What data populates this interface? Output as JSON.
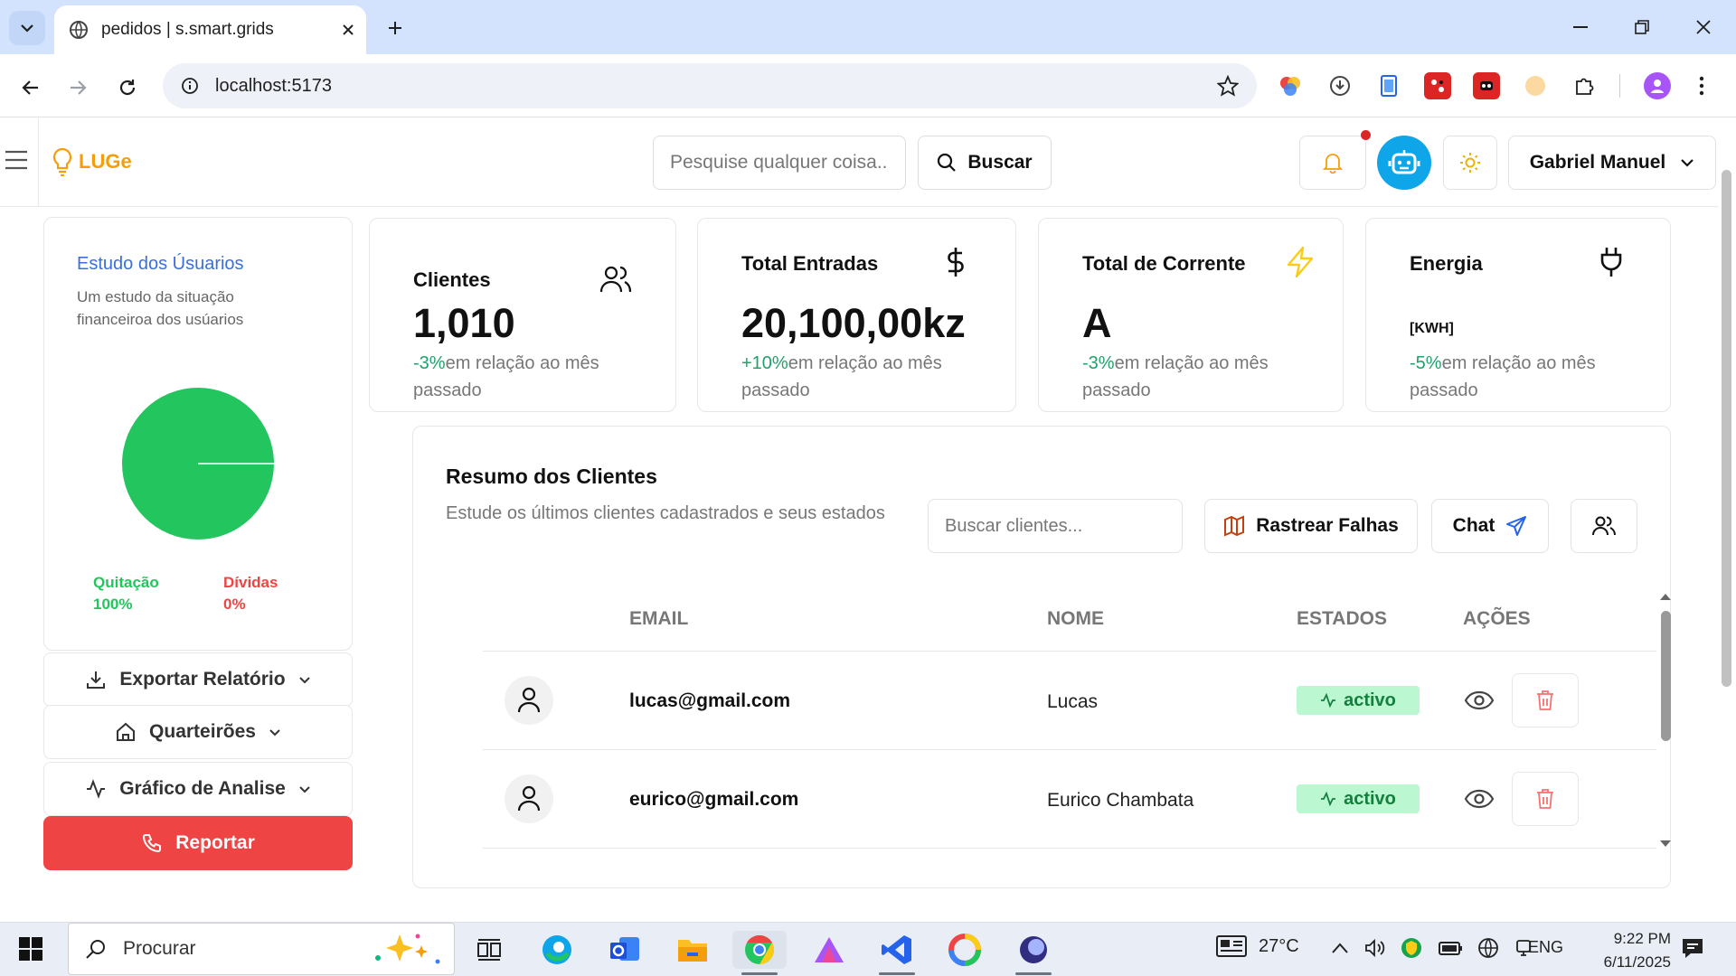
{
  "browser": {
    "tab_title": "pedidos | s.smart.grids",
    "url": "localhost:5173"
  },
  "header": {
    "brand": "LUGe",
    "search_placeholder": "Pesquise qualquer coisa..",
    "search_button": "Buscar",
    "user_name": "Gabriel Manuel",
    "notification_color": "#dc2626",
    "bot_color": "#0ea5e9"
  },
  "sidebar": {
    "study_title": "Estudo dos Úsuarios",
    "study_description": "Um estudo da situação financeiroa dos usúarios",
    "chart_data": {
      "type": "pie",
      "series": [
        {
          "name": "Quitação",
          "value": 100,
          "color": "#22c55e"
        },
        {
          "name": "Dívidas",
          "value": 0,
          "color": "#ef4444"
        }
      ]
    },
    "legend_paid_label": "Quitação",
    "legend_paid_value": "100%",
    "legend_debt_label": "Dívidas",
    "legend_debt_value": "0%",
    "export_button": "Exportar Relatório",
    "blocks_button": "Quarteirões",
    "analysis_button": "Gráfico de Analise",
    "report_button": "Reportar"
  },
  "stats": [
    {
      "label": "Clientes",
      "value": "1,010",
      "unit": "",
      "change": "-3%",
      "change_text": "em relação ao mês passado",
      "icon": "users-icon"
    },
    {
      "label": "Total Entradas",
      "value": "20,100,00kz",
      "unit": "",
      "change": "+10%",
      "change_text": "em relação ao mês passado",
      "icon": "dollar-icon"
    },
    {
      "label": "Total de Corrente",
      "value": "A",
      "unit": "",
      "change": "-3%",
      "change_text": "em relação ao mês passado",
      "icon": "lightning-icon"
    },
    {
      "label": "Energia",
      "value": "",
      "unit": "[KWH]",
      "change": "-5%",
      "change_text": "em relação ao mês passado",
      "icon": "plug-icon"
    }
  ],
  "clients": {
    "title": "Resumo dos Clientes",
    "subtitle": "Estude os últimos clientes cadastrados e seus estados",
    "search_placeholder": "Buscar clientes...",
    "track_button": "Rastrear Falhas",
    "chat_button": "Chat",
    "columns": [
      "EMAIL",
      "NOME",
      "ESTADOS",
      "AÇÕES"
    ],
    "rows": [
      {
        "email": "lucas@gmail.com",
        "name": "Lucas",
        "status": "activo"
      },
      {
        "email": "eurico@gmail.com",
        "name": "Eurico Chambata",
        "status": "activo"
      }
    ]
  },
  "taskbar": {
    "search_placeholder": "Procurar",
    "temperature": "27°C",
    "language": "ENG",
    "time": "9:22 PM",
    "date": "6/11/2025"
  }
}
